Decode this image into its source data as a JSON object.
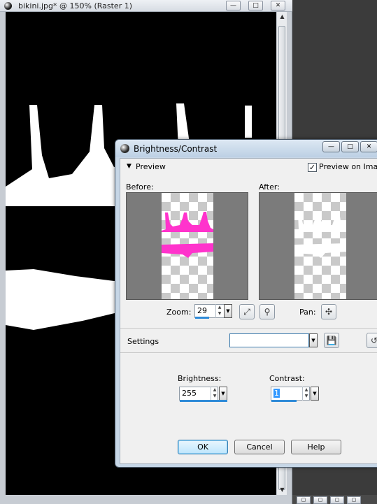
{
  "doc_window": {
    "title": "bikini.jpg* @ 150% (Raster 1)",
    "buttons": {
      "minimize": "—",
      "maximize": "□",
      "close": "✕"
    }
  },
  "dialog": {
    "title": "Brightness/Contrast",
    "buttons": {
      "minimize": "—",
      "maximize": "□",
      "close": "✕"
    },
    "preview_toggle": "Preview",
    "preview_on_image": {
      "label": "Preview on Image",
      "checked": true
    },
    "before_label": "Before:",
    "after_label": "After:",
    "zoom_label": "Zoom:",
    "zoom_value": "29",
    "pan_label": "Pan:",
    "settings_label": "Settings",
    "settings_value": "",
    "brightness_label": "Brightness:",
    "brightness_value": "255",
    "contrast_label": "Contrast:",
    "contrast_value": "1",
    "ok_label": "OK",
    "cancel_label": "Cancel",
    "help_label": "Help"
  },
  "colors": {
    "accent_magenta": "#ff33cc",
    "focus_blue": "#2f8bd8"
  },
  "icons": [
    "app-icon",
    "chevron-down-icon",
    "zoom-fit-icon",
    "zoom-lens-icon",
    "pan-icon",
    "save-preset-icon",
    "reset-icon"
  ]
}
